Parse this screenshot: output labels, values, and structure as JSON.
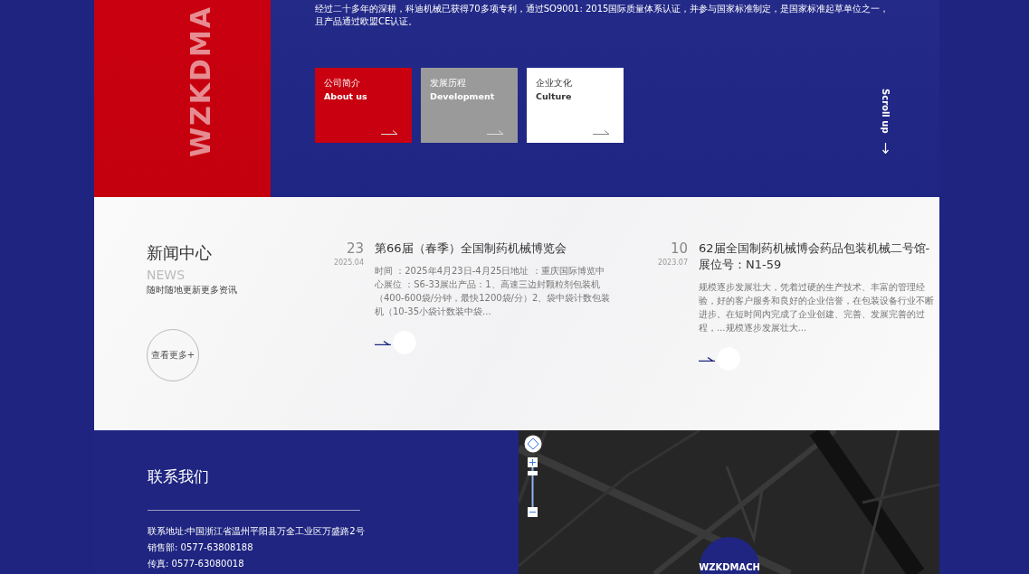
{
  "hero": {
    "brand_text": "WZKDMA",
    "intro": "经过二十多年的深耕，科迪机械已获得70多项专利，通过SO9001: 2015国际质量体系认证，并参与国家标准制定，是国家标准起草单位之一，且产品通过欧盟CE认证。",
    "cards": [
      {
        "title": "公司简介",
        "subtitle": "About us",
        "color": "#c8000f"
      },
      {
        "title": "发展历程",
        "subtitle": "Development",
        "color": "#9a9a9a"
      },
      {
        "title": "企业文化",
        "subtitle": "Culture",
        "color": "#ffffff"
      }
    ],
    "scroll_label": "Scroll up"
  },
  "news": {
    "title": "新闻中心",
    "title_en": "NEWS",
    "subtitle": "随时随地更新更多资讯",
    "more_button": "查看更多+",
    "items": [
      {
        "day": "23",
        "month": "2025.04",
        "title": "第66届（春季）全国制药机械博览会",
        "summary": "时间 ：2025年4月23日-4月25日地址 ：重庆国际博览中心展位 ：S6-33展出产品：1、高速三边封颗粒剂包装机（400-600袋/分钟，最快1200袋/分）2、袋中袋计数包装机（10-35小袋计数装中袋..."
      },
      {
        "day": "10",
        "month": "2023.07",
        "title": "62届全国制药机械博会药品包装机械二号馆-展位号：N1-59",
        "summary": "规模逐步发展壮大，凭着过硬的生产技术、丰富的管理经验，好的客户服务和良好的企业信誉，在包装设备行业不断进步。在短时间内完成了企业创建、完善、发展完善的过程，...规模逐步发展壮大..."
      }
    ]
  },
  "contact": {
    "title": "联系我们",
    "lines": [
      "联系地址:中国浙江省温州平阳县万全工业区万盛路2号",
      "销售部: 0577-63808188",
      "传真: 0577-63080018"
    ],
    "map_marker": "WZKDMACH"
  }
}
